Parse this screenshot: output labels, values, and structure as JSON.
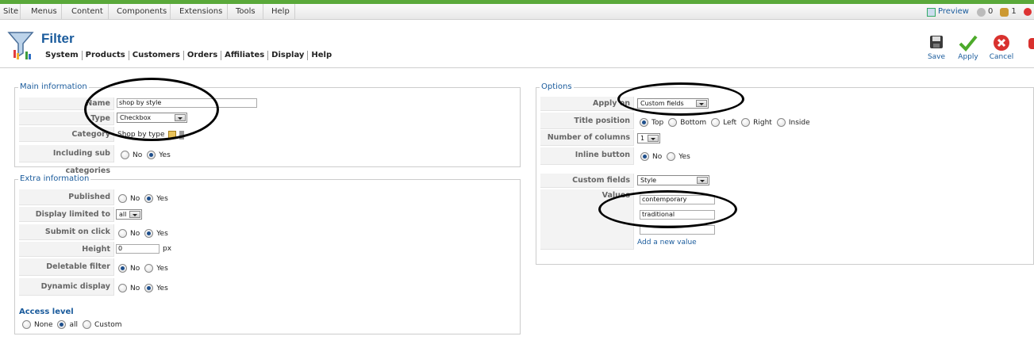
{
  "menu": [
    "Site",
    "Menus",
    "Content",
    "Components",
    "Extensions",
    "Tools",
    "Help"
  ],
  "status": {
    "preview": "Preview",
    "messages": "0",
    "users": "1"
  },
  "page": {
    "title": "Filter"
  },
  "submenu": [
    "System",
    "Products",
    "Customers",
    "Orders",
    "Affiliates",
    "Display",
    "Help"
  ],
  "toolbar": {
    "save": "Save",
    "apply": "Apply",
    "cancel": "Cancel"
  },
  "main": {
    "legend": "Main information",
    "name_label": "Name",
    "name_value": "shop by style",
    "type_label": "Type",
    "type_value": "Checkbox",
    "category_label": "Category",
    "category_value": "Shop by type",
    "sub_label": "Including sub categories",
    "no": "No",
    "yes": "Yes"
  },
  "extra": {
    "legend": "Extra information",
    "published_label": "Published",
    "display_limited_label": "Display limited to",
    "display_limited_value": "all",
    "submit_label": "Submit on click",
    "height_label": "Height",
    "height_value": "0",
    "height_unit": "px",
    "deletable_label": "Deletable filter",
    "dynamic_label": "Dynamic display",
    "no": "No",
    "yes": "Yes",
    "access_label": "Access level",
    "access_none": "None",
    "access_all": "all",
    "access_custom": "Custom"
  },
  "options": {
    "legend": "Options",
    "apply_label": "Apply on",
    "apply_value": "Custom fields",
    "title_pos_label": "Title position",
    "pos_top": "Top",
    "pos_bottom": "Bottom",
    "pos_left": "Left",
    "pos_right": "Right",
    "pos_inside": "Inside",
    "columns_label": "Number of columns",
    "columns_value": "1",
    "inline_label": "Inline button",
    "no": "No",
    "yes": "Yes",
    "custom_fields_label": "Custom fields",
    "custom_fields_value": "Style",
    "values_label": "Values",
    "value_1": "contemporary",
    "value_2": "traditional",
    "add_value": "Add a new value"
  },
  "colors": {
    "accent": "#1a5b9c",
    "topbar": "#5aa93a",
    "cancel": "#d9312e",
    "apply": "#4caa2a"
  }
}
